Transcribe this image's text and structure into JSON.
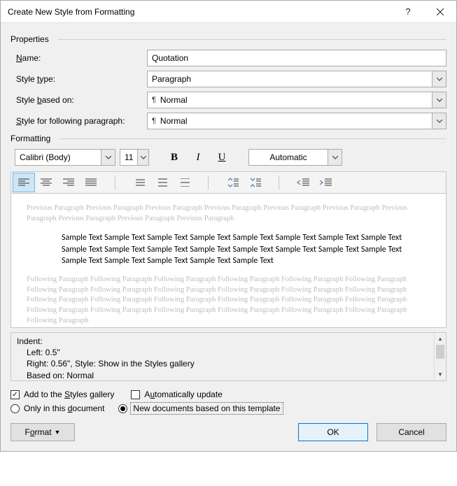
{
  "titlebar": {
    "title": "Create New Style from Formatting"
  },
  "properties": {
    "group_label": "Properties",
    "name_label_pre": "",
    "name_u": "N",
    "name_label_post": "ame:",
    "name_value": "Quotation",
    "type_label_pre": "Style ",
    "type_u": "t",
    "type_label_post": "ype:",
    "type_value": "Paragraph",
    "based_label_pre": "Style ",
    "based_u": "b",
    "based_label_post": "ased on:",
    "based_value": "Normal",
    "following_label_pre": "",
    "following_u": "S",
    "following_label_post": "tyle for following paragraph:",
    "following_value": "Normal"
  },
  "formatting": {
    "group_label": "Formatting",
    "font_name": "Calibri (Body)",
    "font_size": "11",
    "bold": "B",
    "italic": "I",
    "underline": "U",
    "color_label": "Automatic"
  },
  "preview": {
    "ghost_prev": "Previous Paragraph Previous Paragraph Previous Paragraph Previous Paragraph Previous Paragraph Previous Paragraph Previous Paragraph Previous Paragraph Previous Paragraph Previous Paragraph",
    "sample": "Sample Text Sample Text Sample Text Sample Text Sample Text Sample Text Sample Text Sample Text Sample Text Sample Text Sample Text Sample Text Sample Text Sample Text Sample Text Sample Text Sample Text Sample Text Sample Text Sample Text Sample Text",
    "ghost_next": "Following Paragraph Following Paragraph Following Paragraph Following Paragraph Following Paragraph Following Paragraph Following Paragraph Following Paragraph Following Paragraph Following Paragraph Following Paragraph Following Paragraph Following Paragraph Following Paragraph Following Paragraph Following Paragraph Following Paragraph Following Paragraph Following Paragraph Following Paragraph Following Paragraph Following Paragraph Following Paragraph Following Paragraph Following Paragraph"
  },
  "description": {
    "line1": "Indent:",
    "line2": "Left:  0.5\"",
    "line3": "Right:  0.56\", Style: Show in the Styles gallery",
    "line4": "Based on: Normal"
  },
  "options": {
    "add_pre": "Add to the ",
    "add_u": "S",
    "add_post": "tyles gallery",
    "auto_pre": "A",
    "auto_u": "u",
    "auto_post": "tomatically update",
    "only_pre": "Only in this ",
    "only_u": "d",
    "only_post": "ocument",
    "tmpl_label": "New documents based on this template"
  },
  "buttons": {
    "format_pre": "F",
    "format_u": "o",
    "format_post": "rmat",
    "ok": "OK",
    "cancel": "Cancel"
  }
}
